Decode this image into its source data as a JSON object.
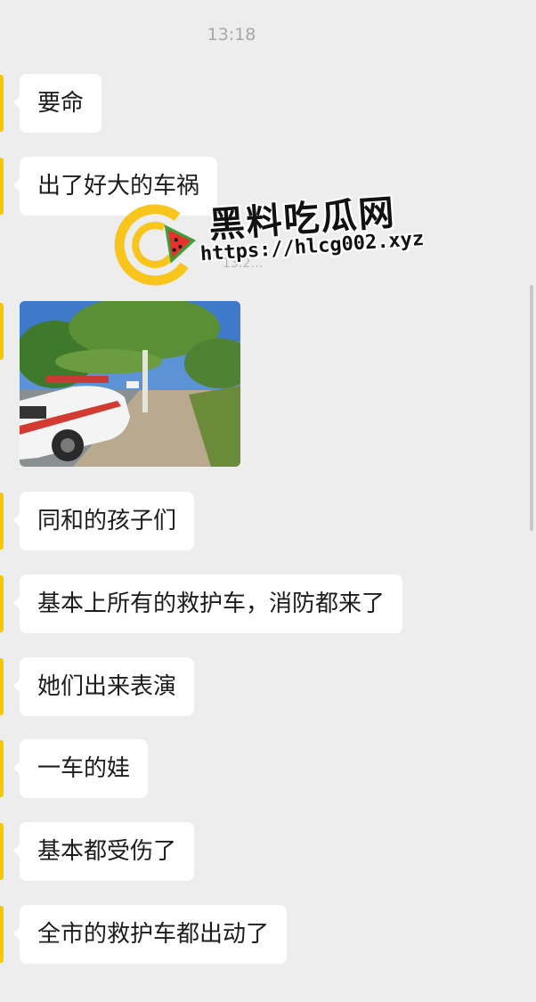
{
  "chat": {
    "timestamp": "13:18",
    "messages": [
      {
        "text": "要命"
      },
      {
        "text": "出了好大的车祸"
      },
      {
        "text": "同和的孩子们"
      },
      {
        "text": "基本上所有的救护车，消防都来了"
      },
      {
        "text": "她们出来表演"
      },
      {
        "text": "一车的娃"
      },
      {
        "text": "基本都受伤了"
      },
      {
        "text": "全市的救护车都出动了"
      }
    ],
    "image_message": {
      "icon": "photo-of-street-with-car"
    },
    "faint_time": "13:2…"
  },
  "watermark": {
    "title": "黑料吃瓜网",
    "url": "https://hlcg002.xyz",
    "logo_icon": "watermelon-c-logo-icon"
  },
  "colors": {
    "background": "#ededed",
    "bubble": "#ffffff",
    "avatar_accent": "#f5c800",
    "logo_yellow": "#f7c51c",
    "logo_red": "#e5322d",
    "logo_green": "#3f9d3a"
  }
}
